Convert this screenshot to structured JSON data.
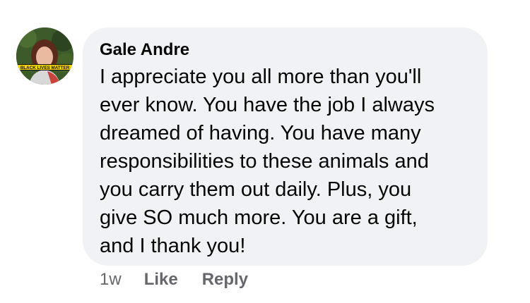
{
  "comment": {
    "author": "Gale Andre",
    "lines": [
      "I appreciate you all more than you'll",
      "ever know. You have the job I always",
      "dreamed of having. You have many",
      "responsibilities to these animals and",
      "you carry them out daily. Plus, you",
      "give SO much more. You are a gift,",
      "and I thank you!"
    ],
    "avatar_badge_text": "BLACK LIVES MATTER",
    "timestamp": "1w",
    "like_label": "Like",
    "reply_label": "Reply"
  },
  "colors": {
    "bubble_bg": "#f0f2f5",
    "text_primary": "#050505",
    "text_secondary": "#65676b",
    "badge_yellow": "#f5d400"
  }
}
